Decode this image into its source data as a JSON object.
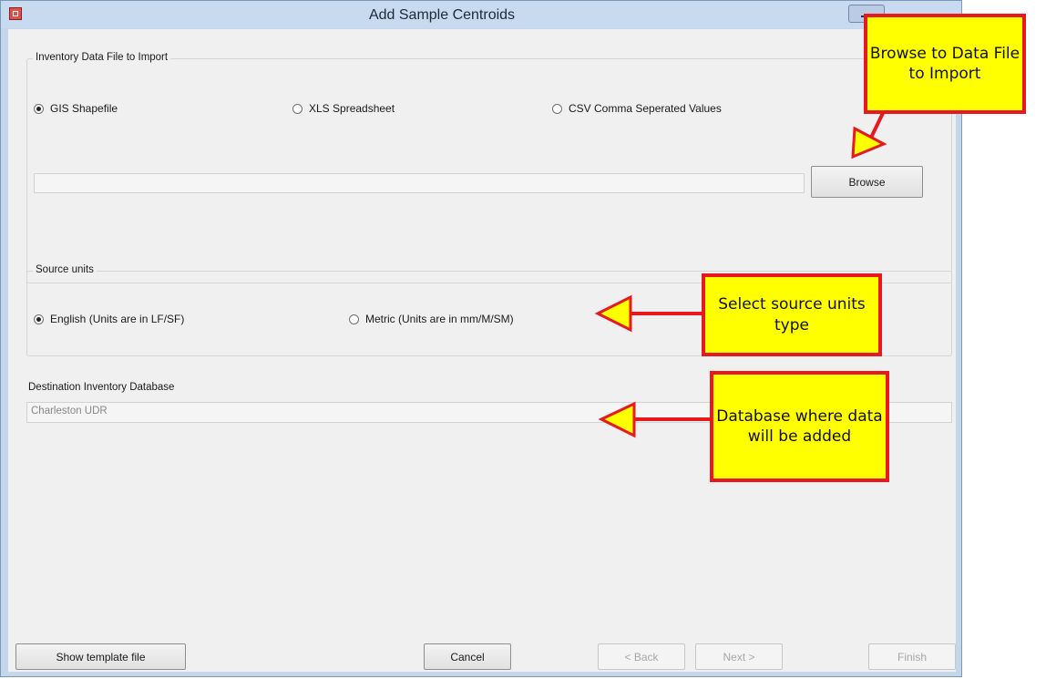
{
  "window": {
    "title": "Add Sample Centroids"
  },
  "inventory_group": {
    "legend": "Inventory Data File to Import",
    "options": [
      {
        "label": "GIS Shapefile",
        "checked": true
      },
      {
        "label": "XLS Spreadsheet",
        "checked": false
      },
      {
        "label": "CSV  Comma Seperated Values",
        "checked": false
      }
    ],
    "file_path": "",
    "browse_label": "Browse"
  },
  "units_group": {
    "legend": "Source units",
    "options": [
      {
        "label": "English (Units are in LF/SF)",
        "checked": true
      },
      {
        "label": "Metric (Units are in mm/M/SM)",
        "checked": false
      }
    ]
  },
  "destination": {
    "label": "Destination Inventory Database",
    "value": "Charleston UDR"
  },
  "footer": {
    "show_template_label": "Show template file",
    "cancel_label": "Cancel",
    "back_label": "< Back",
    "next_label": "Next >",
    "finish_label": "Finish"
  },
  "callouts": {
    "browse": "Browse to Data File to Import",
    "units": "Select source units type",
    "database": "Database where data will be added"
  },
  "colors": {
    "callout_fill": "#ffff00",
    "callout_border": "#e8181f"
  }
}
